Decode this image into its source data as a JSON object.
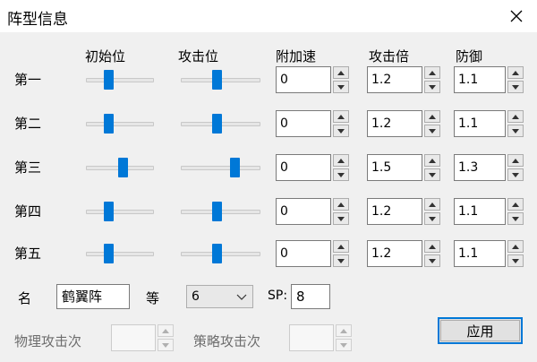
{
  "window": {
    "title": "阵型信息"
  },
  "headers": {
    "initial_position": "初始位",
    "attack_position": "攻击位",
    "extra_speed": "附加速",
    "attack_multiplier": "攻击倍",
    "defense": "防御"
  },
  "rows": [
    {
      "label": "第一",
      "initial_slider": 0.3,
      "attack_slider": 0.45,
      "extra_speed": "0",
      "attack_mult": "1.2",
      "defense": "1.1"
    },
    {
      "label": "第二",
      "initial_slider": 0.3,
      "attack_slider": 0.45,
      "extra_speed": "0",
      "attack_mult": "1.2",
      "defense": "1.1"
    },
    {
      "label": "第三",
      "initial_slider": 0.55,
      "attack_slider": 0.7,
      "extra_speed": "0",
      "attack_mult": "1.5",
      "defense": "1.3"
    },
    {
      "label": "第四",
      "initial_slider": 0.3,
      "attack_slider": 0.45,
      "extra_speed": "0",
      "attack_mult": "1.2",
      "defense": "1.1"
    },
    {
      "label": "第五",
      "initial_slider": 0.3,
      "attack_slider": 0.45,
      "extra_speed": "0",
      "attack_mult": "1.2",
      "defense": "1.1"
    }
  ],
  "form": {
    "name_label": "名",
    "name_value": "鹤翼阵",
    "level_label": "等",
    "level_value": "6",
    "sp_label": "SP:",
    "sp_value": "8",
    "physical_attack_label": "物理攻击次",
    "physical_attack_value": "",
    "strategy_attack_label": "策略攻击次",
    "strategy_attack_value": ""
  },
  "buttons": {
    "apply": "应用"
  },
  "icons": {
    "close": "close-icon",
    "up": "chevron-up-icon",
    "down": "chevron-down-icon",
    "dropdown": "chevron-down-icon"
  },
  "colors": {
    "accent": "#0078d7"
  }
}
